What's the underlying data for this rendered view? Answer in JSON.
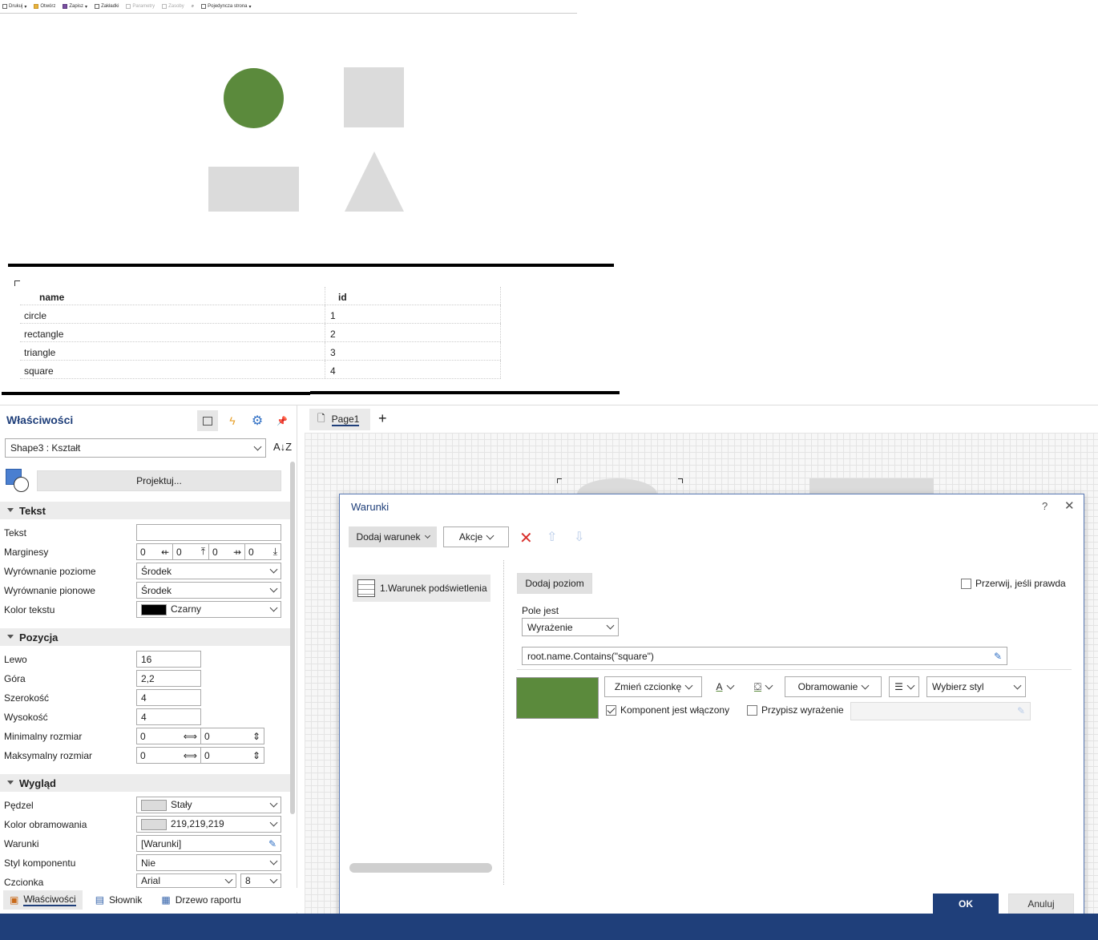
{
  "viewer_toolbar": {
    "items": [
      "Drukuj",
      "Otwórz",
      "Zapisz",
      "Zakładki",
      "Parametry",
      "Zasoby",
      "Pojedyncza strona"
    ]
  },
  "table": {
    "headers": {
      "name": "name",
      "id": "id"
    },
    "rows": [
      {
        "name": "circle",
        "id": "1"
      },
      {
        "name": "rectangle",
        "id": "2"
      },
      {
        "name": "triangle",
        "id": "3"
      },
      {
        "name": "square",
        "id": "4"
      }
    ]
  },
  "properties": {
    "title": "Właściwości",
    "selected_component": "Shape3 : Kształt",
    "design_button": "Projektuj...",
    "sections": {
      "text": "Tekst",
      "position": "Pozycja",
      "appearance": "Wygląd"
    },
    "text_props": {
      "text_label": "Tekst",
      "text_value": "",
      "margins_label": "Marginesy",
      "margins": [
        "0",
        "0",
        "0",
        "0"
      ],
      "halign_label": "Wyrównanie poziome",
      "halign_value": "Środek",
      "valign_label": "Wyrównanie pionowe",
      "valign_value": "Środek",
      "color_label": "Kolor tekstu",
      "color_value": "Czarny",
      "color_swatch": "#000000"
    },
    "position_props": {
      "left_label": "Lewo",
      "left_value": "16",
      "top_label": "Góra",
      "top_value": "2,2",
      "width_label": "Szerokość",
      "width_value": "4",
      "height_label": "Wysokość",
      "height_value": "4",
      "min_label": "Minimalny rozmiar",
      "min_values": [
        "0",
        "0"
      ],
      "max_label": "Maksymalny rozmiar",
      "max_values": [
        "0",
        "0"
      ]
    },
    "appearance_props": {
      "brush_label": "Pędzel",
      "brush_value": "Stały",
      "brush_swatch": "#dbdbdb",
      "border_label": "Kolor obramowania",
      "border_value": "219,219,219",
      "border_swatch": "#dbdbdb",
      "conditions_label": "Warunki",
      "conditions_value": "[Warunki]",
      "style_label": "Styl komponentu",
      "style_value": "Nie",
      "font_label": "Czcionka",
      "font_value": "Arial",
      "font_size": "8"
    }
  },
  "bottom_tabs": [
    "Właściwości",
    "Słownik",
    "Drzewo raportu"
  ],
  "page_tab": "Page1",
  "modal": {
    "title": "Warunki",
    "help": "?",
    "add_condition": "Dodaj warunek",
    "actions": "Akcje",
    "condition_item": "1.Warunek podświetlenia",
    "add_level": "Dodaj poziom",
    "break_if_true": "Przerwij, jeśli prawda",
    "field_is_label": "Pole jest",
    "field_is_value": "Wyrażenie",
    "expression": "root.name.Contains(\"square\")",
    "preview_color": "#5b8a3c",
    "change_font": "Zmień czcionkę",
    "border_btn": "Obramowanie",
    "choose_style": "Wybierz styl",
    "component_enabled": "Komponent jest włączony",
    "assign_expression": "Przypisz wyrażenie",
    "ok": "OK",
    "cancel": "Anuluj"
  },
  "colors": {
    "accent": "#1f3f7a",
    "green": "#5b8a3c",
    "shape_gray": "#dbdbdb",
    "delete_red": "#d9302c"
  }
}
